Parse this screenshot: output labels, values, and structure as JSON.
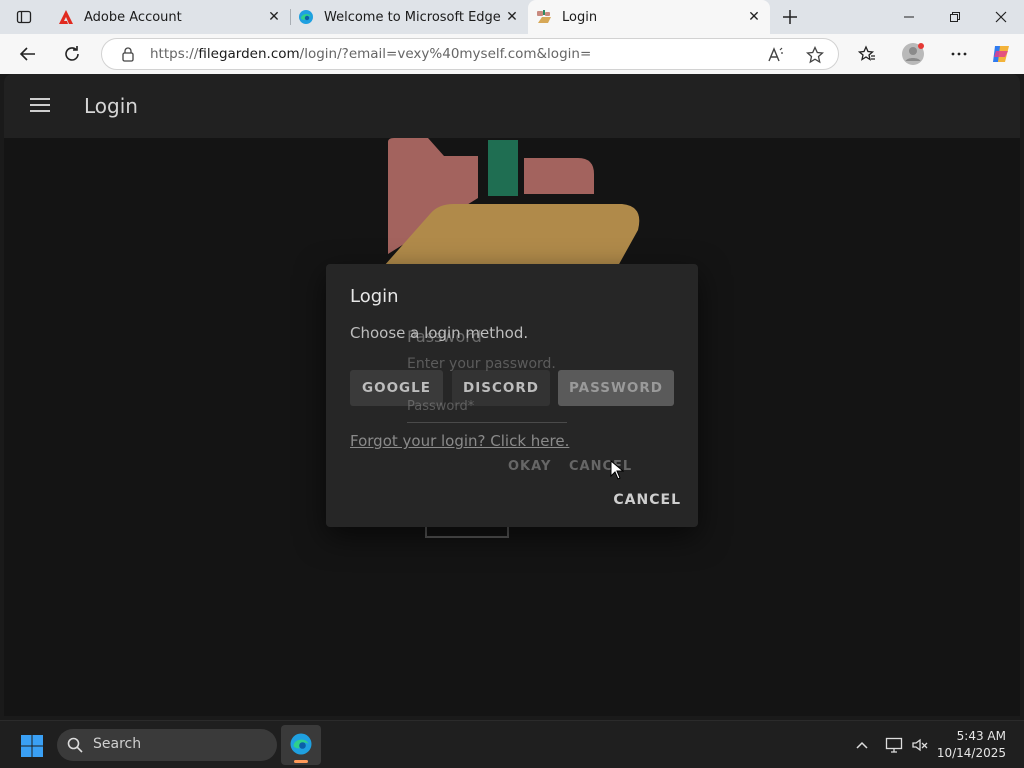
{
  "browser": {
    "tabs": [
      {
        "label": "Adobe Account",
        "icon": "adobe-icon"
      },
      {
        "label": "Welcome to Microsoft Edge",
        "icon": "edge-icon"
      },
      {
        "label": "Login",
        "icon": "filegarden-icon",
        "active": true
      }
    ],
    "url_prefix": "https://",
    "url_host": "filegarden.com",
    "url_path": "/login/?email=vexy%40myself.com&login="
  },
  "app": {
    "title": "Login"
  },
  "dialog": {
    "title": "Login",
    "subtitle": "Choose a login method.",
    "buttons": {
      "google": "GOOGLE",
      "discord": "DISCORD",
      "password": "PASSWORD"
    },
    "forgot": "Forgot your login? Click here.",
    "cancel": "CANCEL"
  },
  "password_dialog": {
    "title": "Password",
    "description": "Enter your password.",
    "field_label": "Password*",
    "okay": "OKAY",
    "cancel": "CANCEL"
  },
  "taskbar": {
    "search_label": "Search",
    "time": "5:43 AM",
    "date": "10/14/2025"
  },
  "colors": {
    "logo_pink": "#a3635e",
    "logo_green": "#1f6e52",
    "logo_gold": "#b08a4a"
  }
}
